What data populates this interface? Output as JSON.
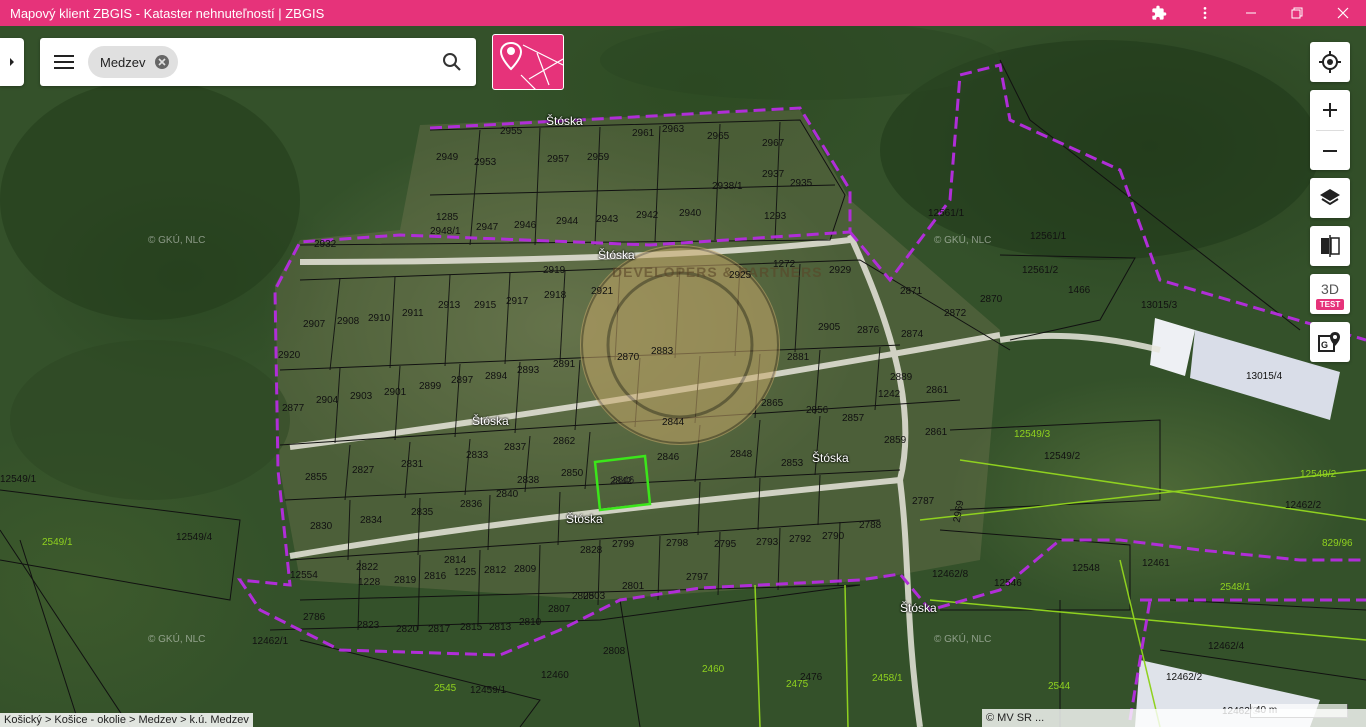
{
  "window": {
    "title": "Mapový klient ZBGIS - Kataster nehnuteľností | ZBGIS",
    "icons": [
      "extension-icon",
      "more-vert-icon",
      "minimize-icon",
      "restore-icon",
      "close-icon"
    ]
  },
  "search": {
    "chip_label": "Medzev",
    "icons": [
      "menu-icon",
      "chip-remove-icon",
      "search-icon"
    ]
  },
  "controls": {
    "three_d_label": "3D",
    "test_badge": "TEST",
    "icons": [
      "my-location-icon",
      "zoom-in-icon",
      "zoom-out-icon",
      "layers-icon",
      "compare-icon",
      "google-maps-icon",
      "cadastre-parcel-icon"
    ]
  },
  "map": {
    "streets": [
      "Štóska",
      "Štóska",
      "Štóska",
      "Štóska",
      "Štóska",
      "Štóska"
    ],
    "watermark": "© GKÚ, NLC",
    "stamp_text": "DEVELOPERS & PARTNERS",
    "parcels": [
      "2955",
      "2961",
      "2963",
      "2965",
      "2967",
      "2949",
      "2953",
      "2957",
      "2959",
      "2937",
      "2935",
      "2938/1",
      "1285",
      "2948/1",
      "2947",
      "2946",
      "2944",
      "2943",
      "2942",
      "2940",
      "1293",
      "12561/1",
      "2932",
      "2919",
      "2921",
      "2925",
      "1272",
      "2929",
      "12561/1",
      "12561/2",
      "1466",
      "2871",
      "2870",
      "13015/3",
      "13015/4",
      "2907",
      "2908",
      "2910",
      "2911",
      "2913",
      "2915",
      "2917",
      "2918",
      "2920",
      "2905",
      "2876",
      "2874",
      "2872",
      "2870",
      "2883",
      "2881",
      "2877",
      "2904",
      "2903",
      "2901",
      "2899",
      "2897",
      "2894",
      "2893",
      "2891",
      "2889",
      "1242",
      "2861",
      "2865",
      "2856",
      "2857",
      "2859",
      "2861",
      "2862",
      "2844",
      "2850",
      "2842",
      "2846",
      "2848",
      "2853",
      "2855",
      "2827",
      "2831",
      "2833",
      "2837",
      "2838",
      "2840",
      "2836",
      "2835",
      "2834",
      "2830",
      "2828",
      "2799",
      "2798",
      "2795",
      "2793",
      "2792",
      "2790",
      "2788",
      "2787",
      "2969",
      "12549/2",
      "12549/3",
      "12549/4",
      "12554",
      "2822",
      "1228",
      "2819",
      "2816",
      "2814",
      "1225",
      "2812",
      "2809",
      "2807",
      "2805",
      "2803",
      "2801",
      "2797",
      "2786",
      "2823",
      "2820",
      "2817",
      "2815",
      "2813",
      "2810",
      "2808",
      "12462/1",
      "12459/1",
      "12460",
      "12461",
      "12462/2",
      "12462/3",
      "12462/4",
      "12462/8",
      "12546",
      "12548",
      "829/96",
      "2548/1",
      "2544",
      "2545",
      "2460",
      "2475",
      "2476",
      "12462/2",
      "12549/2",
      "12549/1",
      "2549/1",
      "2458/1",
      "2466",
      "2470"
    ],
    "selected_parcel": "2846",
    "scale_label": "40 m"
  },
  "breadcrumb": "Košický > Košice - okolie > Medzev > k.ú. Medzev",
  "attribution": "© MV SR ..."
}
